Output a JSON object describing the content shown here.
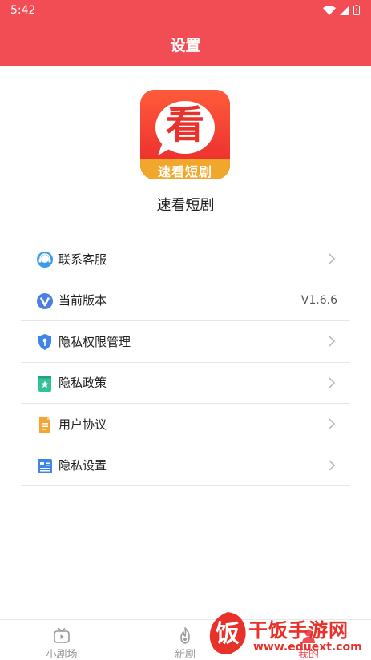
{
  "status_bar": {
    "time": "5:42"
  },
  "header": {
    "title": "设置"
  },
  "app": {
    "logo_text": "速看短剧",
    "logo_glyph": "看",
    "name": "速看短剧"
  },
  "menu": [
    {
      "label": "联系客服",
      "icon": "headset-icon",
      "icon_color": "#3a9be8",
      "trailing": "chevron"
    },
    {
      "label": "当前版本",
      "icon": "version-v-icon",
      "icon_color": "#4a7fe3",
      "trailing": "value",
      "value": "V1.6.6"
    },
    {
      "label": "隐私权限管理",
      "icon": "shield-key-icon",
      "icon_color": "#3d86e8",
      "trailing": "chevron"
    },
    {
      "label": "隐私政策",
      "icon": "bookmark-star-icon",
      "icon_color": "#32c29a",
      "trailing": "chevron"
    },
    {
      "label": "用户协议",
      "icon": "document-icon",
      "icon_color": "#f5a532",
      "trailing": "chevron"
    },
    {
      "label": "隐私设置",
      "icon": "id-card-icon",
      "icon_color": "#3d86e8",
      "trailing": "chevron"
    }
  ],
  "tabbar": {
    "tabs": [
      {
        "label": "小剧场",
        "icon": "tv-icon",
        "active": false
      },
      {
        "label": "新剧",
        "icon": "flame-icon",
        "active": false
      },
      {
        "label": "我的",
        "icon": "user-icon",
        "active": true
      }
    ]
  },
  "watermark": {
    "title": "干饭手游网",
    "url": "www.eduext.com",
    "glyph": "饭"
  },
  "colors": {
    "brand_red": "#f24c55",
    "divider": "#e6e6e6",
    "text": "#222222",
    "muted": "#999999"
  }
}
